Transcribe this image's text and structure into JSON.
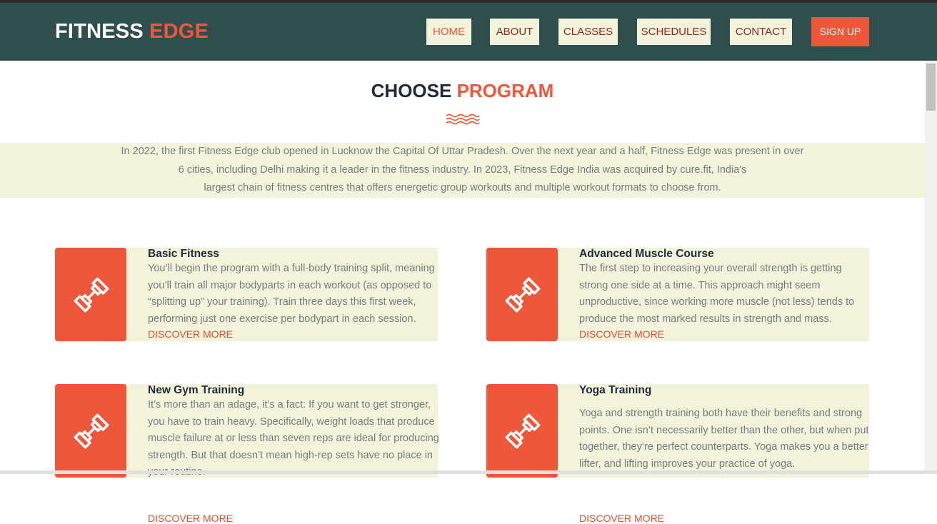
{
  "brand": {
    "part1": "FITNESS",
    "part2": "EDGE"
  },
  "nav": {
    "items": [
      {
        "label": "HOME",
        "active": true
      },
      {
        "label": "ABOUT",
        "active": false
      },
      {
        "label": "CLASSES",
        "active": false
      },
      {
        "label": "SCHEDULES",
        "active": false
      },
      {
        "label": "CONTACT",
        "active": false
      }
    ],
    "signup_label": "SIGN UP"
  },
  "section": {
    "title_part1": "CHOOSE",
    "title_part2": "PROGRAM",
    "intro_lines": [
      "In 2022, the first Fitness Edge club opened in Lucknow the Capital Of Uttar Pradesh. Over the next year and a half, Fitness Edge was present in over",
      "6 cities, including Delhi making it a leader in the fitness industry. In 2023, Fitness Edge India was acquired by cure.fit, India's",
      "largest chain of fitness centres that offers energetic group workouts and multiple workout formats to choose from."
    ]
  },
  "programs": [
    {
      "title": "Basic Fitness",
      "text": "You’ll begin the program with a full-body training split, meaning you’ll train all major bodyparts in each workout (as opposed to “splitting up” your training). Train three days this first week, performing just one exercise per bodypart in each session.",
      "link": "DISCOVER MORE",
      "icon": "dumbbell-icon"
    },
    {
      "title": "Advanced Muscle Course",
      "text": "The first step to increasing your overall strength is getting strong one side at a time. This approach might seem unproductive, since working more muscle (not less) tends to produce the most marked results in strength and mass.",
      "link": "DISCOVER MORE",
      "icon": "dumbbell-icon"
    },
    {
      "title": "New Gym Training",
      "text": "It’s more than an adage, it’s a fact: If you want to get stronger, you have to train heavy. Specifically, weight loads that produce muscle failure at or less than seven reps are ideal for producing strength. But that doesn’t mean high-rep sets have no place in your routine.",
      "link": "DISCOVER MORE",
      "icon": "dumbbell-icon"
    },
    {
      "title": "Yoga Training",
      "text": "Yoga and strength training both have their benefits and strong points. One isn’t necessarily better than the other, but when put together, they’re perfect counterparts. Yoga makes you a better lifter, and lifting improves your practice of yoga.",
      "link": "DISCOVER MORE",
      "icon": "dumbbell-icon"
    }
  ],
  "colors": {
    "header_bg": "#2f4f4f",
    "accent": "#ee573a",
    "cream": "#f3f3dc",
    "nav_text": "#8a2a1a",
    "title_dark": "#1f2a3a",
    "body_text": "#7a7a7a"
  }
}
